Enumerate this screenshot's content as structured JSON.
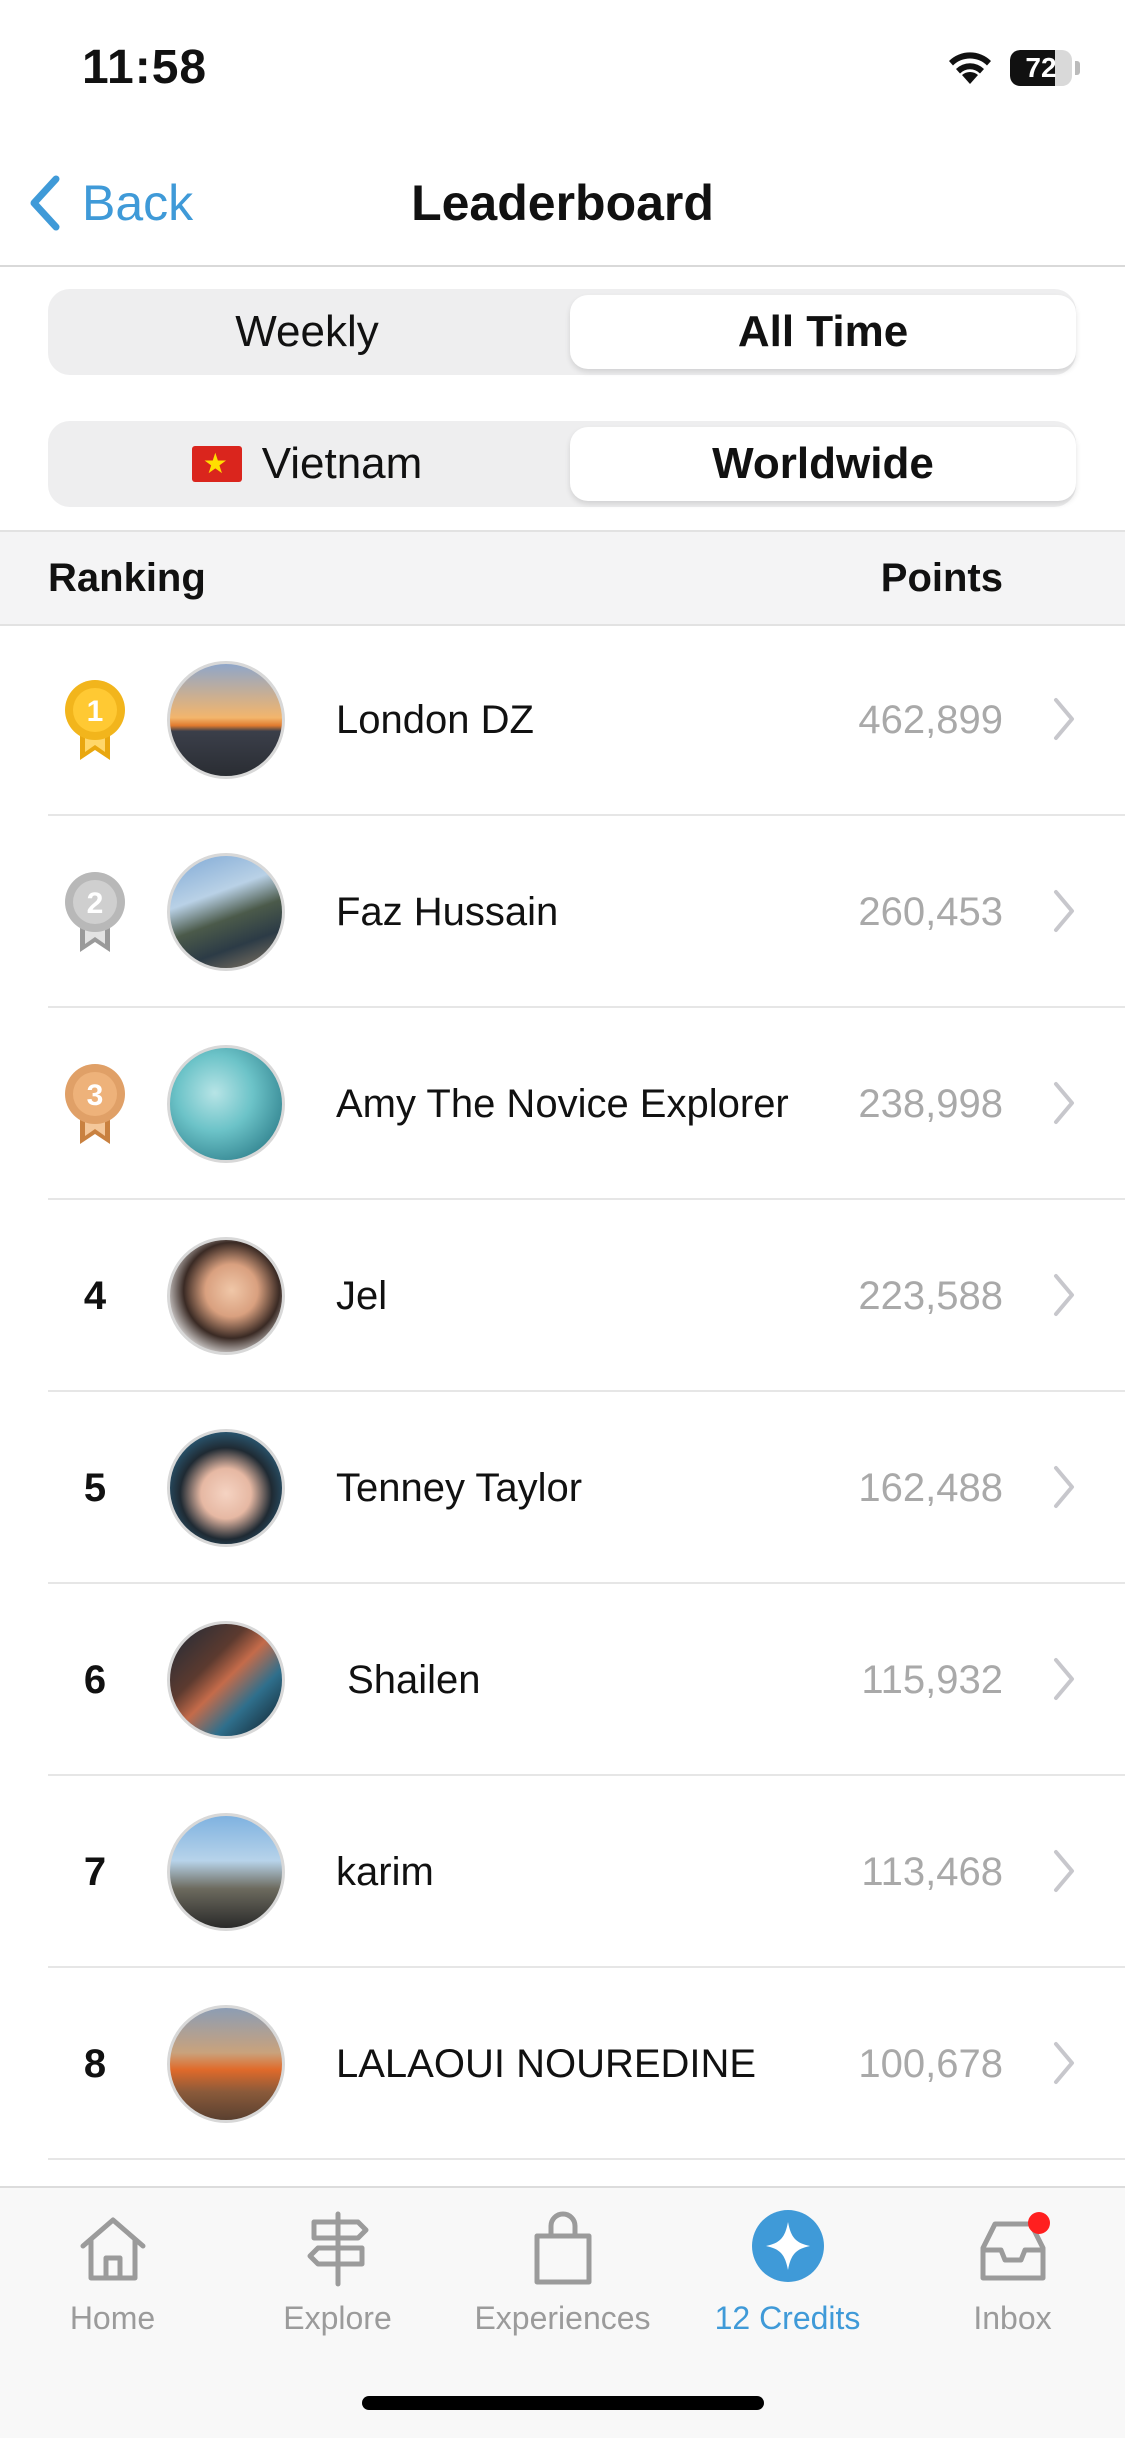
{
  "status_bar": {
    "time": "11:58",
    "battery": "72",
    "battery_level": 0.72
  },
  "nav": {
    "back_label": "Back",
    "title": "Leaderboard"
  },
  "period_toggle": {
    "options": [
      "Weekly",
      "All Time"
    ],
    "selected": "All Time"
  },
  "region_toggle": {
    "options": [
      "Vietnam",
      "Worldwide"
    ],
    "selected": "Worldwide"
  },
  "table": {
    "ranking_header": "Ranking",
    "points_header": "Points"
  },
  "rows": [
    {
      "rank": "1",
      "medal": "gold",
      "name": "London DZ",
      "points": "462,899"
    },
    {
      "rank": "2",
      "medal": "silver",
      "name": "Faz Hussain",
      "points": "260,453"
    },
    {
      "rank": "3",
      "medal": "bronze",
      "name": "Amy The Novice Explorer",
      "points": "238,998"
    },
    {
      "rank": "4",
      "name": "Jel",
      "points": "223,588"
    },
    {
      "rank": "5",
      "name": "Tenney Taylor",
      "points": "162,488"
    },
    {
      "rank": "6",
      "name": " Shailen",
      "points": "115,932"
    },
    {
      "rank": "7",
      "name": "karim",
      "points": "113,468"
    },
    {
      "rank": "8",
      "name": "LALAOUI NOUREDINE",
      "points": "100,678"
    }
  ],
  "tabs": [
    {
      "label": "Home",
      "icon": "home-icon"
    },
    {
      "label": "Explore",
      "icon": "signpost-icon"
    },
    {
      "label": "Experiences",
      "icon": "shopping-bag-icon"
    },
    {
      "label": "12 Credits",
      "icon": "credits-star-icon",
      "active": true
    },
    {
      "label": "Inbox",
      "icon": "inbox-icon",
      "badge": true
    }
  ],
  "colors": {
    "accent": "#3f9ad8",
    "gold": "#f2b51c",
    "silver": "#b8b8b8",
    "bronze": "#e0a067",
    "badge": "#ff1f1f"
  }
}
